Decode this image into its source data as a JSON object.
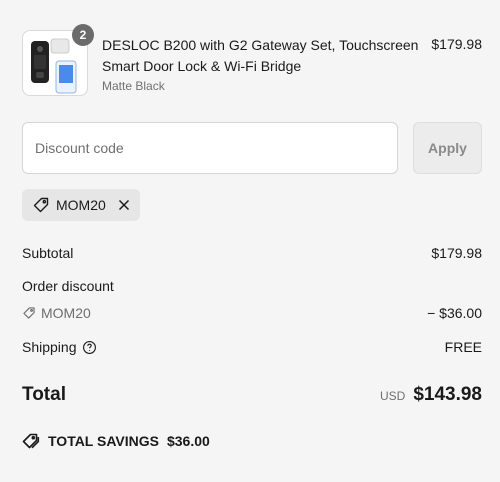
{
  "product": {
    "quantity": "2",
    "name": "DESLOC B200 with G2 Gateway Set, Touchscreen Smart Door Lock & Wi-Fi Bridge",
    "variant": "Matte Black",
    "price": "$179.98"
  },
  "discount": {
    "placeholder": "Discount code",
    "apply_label": "Apply",
    "applied_code": "MOM20"
  },
  "summary": {
    "subtotal_label": "Subtotal",
    "subtotal_value": "$179.98",
    "order_discount_label": "Order discount",
    "order_discount_code": "MOM20",
    "order_discount_value": "− $36.00",
    "shipping_label": "Shipping",
    "shipping_value": "FREE",
    "total_label": "Total",
    "total_currency": "USD",
    "total_value": "$143.98",
    "savings_label": "TOTAL SAVINGS",
    "savings_value": "$36.00"
  },
  "icons": {
    "tag": "tag-icon",
    "close": "close-icon",
    "help": "help-circle-icon",
    "savings": "double-tag-icon"
  }
}
